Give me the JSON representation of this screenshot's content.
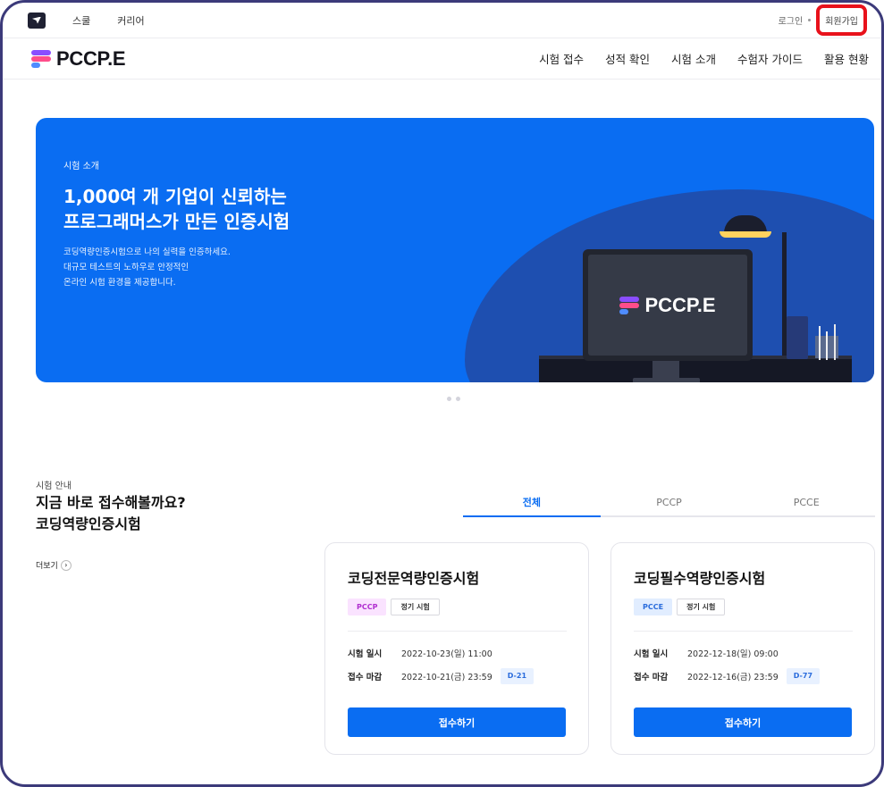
{
  "util": {
    "links": [
      "스쿨",
      "커리어"
    ],
    "login": "로그인",
    "signup": "회원가입"
  },
  "nav": {
    "brand": "PCCP.E",
    "items": [
      "시험 접수",
      "성적 확인",
      "시험 소개",
      "수험자 가이드",
      "활용 현황"
    ]
  },
  "hero": {
    "label": "시험 소개",
    "title_line1": "1,000여 개 기업이 신뢰하는",
    "title_line2": "프로그래머스가 만든 인증시험",
    "desc_line1": "코딩역량인증시험으로 나의 실력을 인증하세요.",
    "desc_line2": "대규모 테스트의 노하우로 안정적인",
    "desc_line3": "온라인 시험 환경을 제공합니다.",
    "screen_brand": "PCCP.E",
    "accent": "#0a6df2"
  },
  "section": {
    "label": "시험 안내",
    "title_line1": "지금 바로 접수해볼까요?",
    "title_line2": "코딩역량인증시험",
    "more": "더보기"
  },
  "tabs": [
    "전체",
    "PCCP",
    "PCCE"
  ],
  "cards": [
    {
      "title": "코딩전문역량인증시험",
      "type": "PCCP",
      "kind": "정기 시험",
      "date_label": "시험 일시",
      "date": "2022-10-23(일) 11:00",
      "deadline_label": "접수 마감",
      "deadline": "2022-10-21(금) 23:59",
      "dday": "D-21",
      "button": "접수하기"
    },
    {
      "title": "코딩필수역량인증시험",
      "type": "PCCE",
      "kind": "정기 시험",
      "date_label": "시험 일시",
      "date": "2022-12-18(일) 09:00",
      "deadline_label": "접수 마감",
      "deadline": "2022-12-16(금) 23:59",
      "dday": "D-77",
      "button": "접수하기"
    }
  ]
}
